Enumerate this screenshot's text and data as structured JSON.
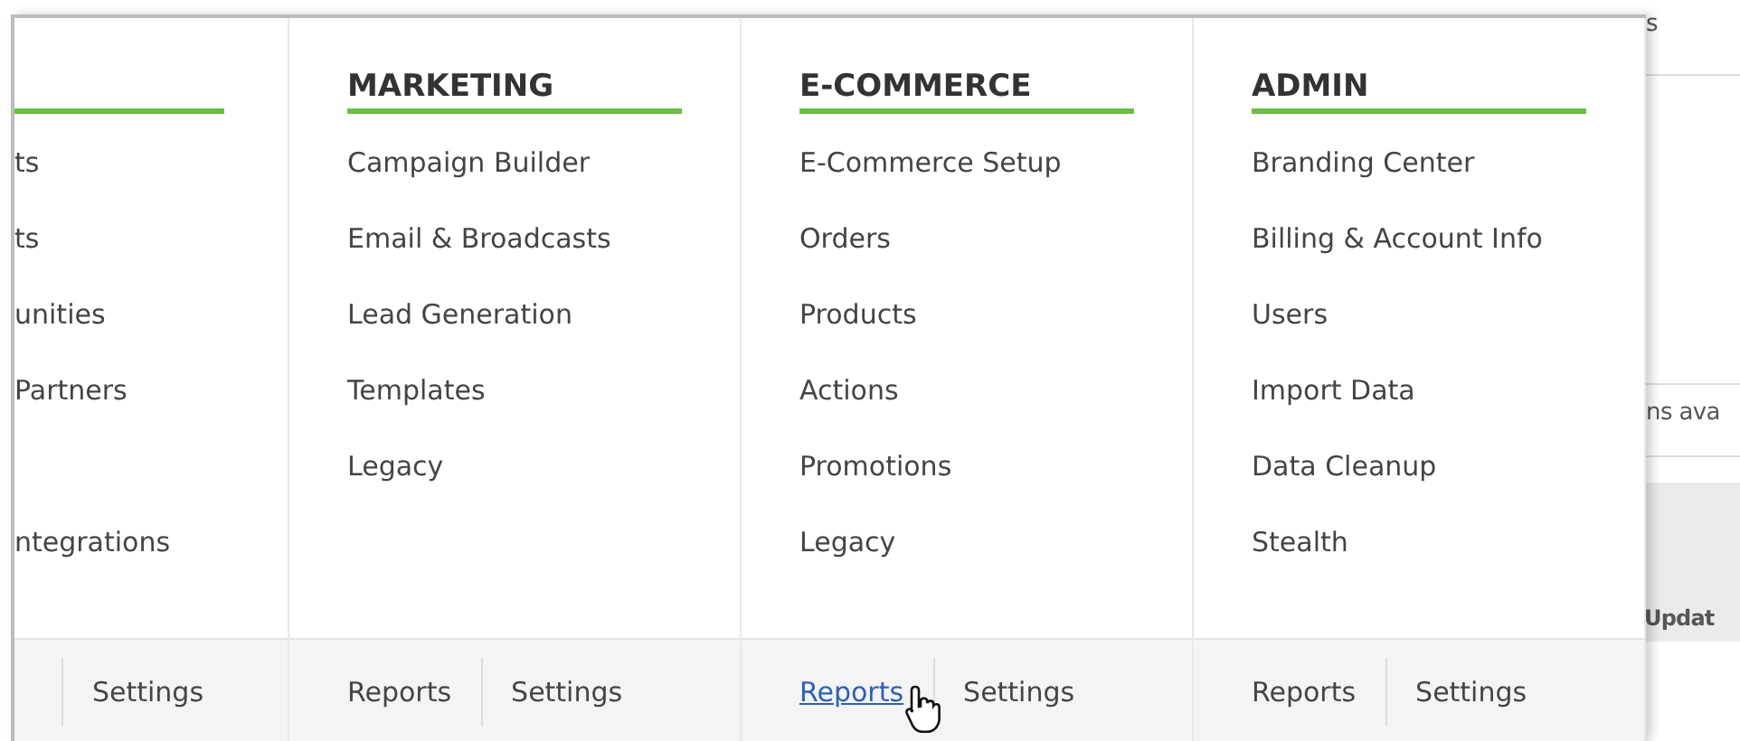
{
  "background_page": {
    "texts": [
      "s",
      "ns ava"
    ],
    "table_header": "Updat"
  },
  "menu": {
    "columns": [
      {
        "items": [
          {
            "label": "ts",
            "kind": "link"
          },
          {
            "label": "ts",
            "kind": "link"
          },
          {
            "label": "unities",
            "kind": "link"
          },
          {
            "label": "Partners",
            "kind": "link"
          },
          {
            "label": "ntegrations",
            "kind": "after-gap"
          }
        ],
        "footer": [
          {
            "label": "Settings",
            "hovered": false
          }
        ]
      },
      {
        "heading": "MARKETING",
        "items": [
          {
            "label": "Campaign Builder",
            "kind": "link"
          },
          {
            "label": "Email & Broadcasts",
            "kind": "link"
          },
          {
            "label": "Lead Generation",
            "kind": "link"
          },
          {
            "label": "Templates",
            "kind": "link"
          },
          {
            "label": "Legacy",
            "kind": "link"
          }
        ],
        "footer": [
          {
            "label": "Reports",
            "hovered": false
          },
          {
            "label": "Settings",
            "hovered": false
          }
        ]
      },
      {
        "heading": "E-COMMERCE",
        "items": [
          {
            "label": "E-Commerce Setup",
            "kind": "link"
          },
          {
            "label": "Orders",
            "kind": "link"
          },
          {
            "label": "Products",
            "kind": "link"
          },
          {
            "label": "Actions",
            "kind": "link"
          },
          {
            "label": "Promotions",
            "kind": "link"
          },
          {
            "label": "Legacy",
            "kind": "link"
          }
        ],
        "footer": [
          {
            "label": "Reports",
            "hovered": true
          },
          {
            "label": "Settings",
            "hovered": false
          }
        ]
      },
      {
        "heading": "ADMIN",
        "items": [
          {
            "label": "Branding Center",
            "kind": "link"
          },
          {
            "label": "Billing & Account Info",
            "kind": "link"
          },
          {
            "label": "Users",
            "kind": "link"
          },
          {
            "label": "Import Data",
            "kind": "link"
          },
          {
            "label": "Data Cleanup",
            "kind": "link"
          },
          {
            "label": "Stealth",
            "kind": "link"
          }
        ],
        "footer": [
          {
            "label": "Reports",
            "hovered": false
          },
          {
            "label": "Settings",
            "hovered": false
          }
        ]
      }
    ]
  }
}
